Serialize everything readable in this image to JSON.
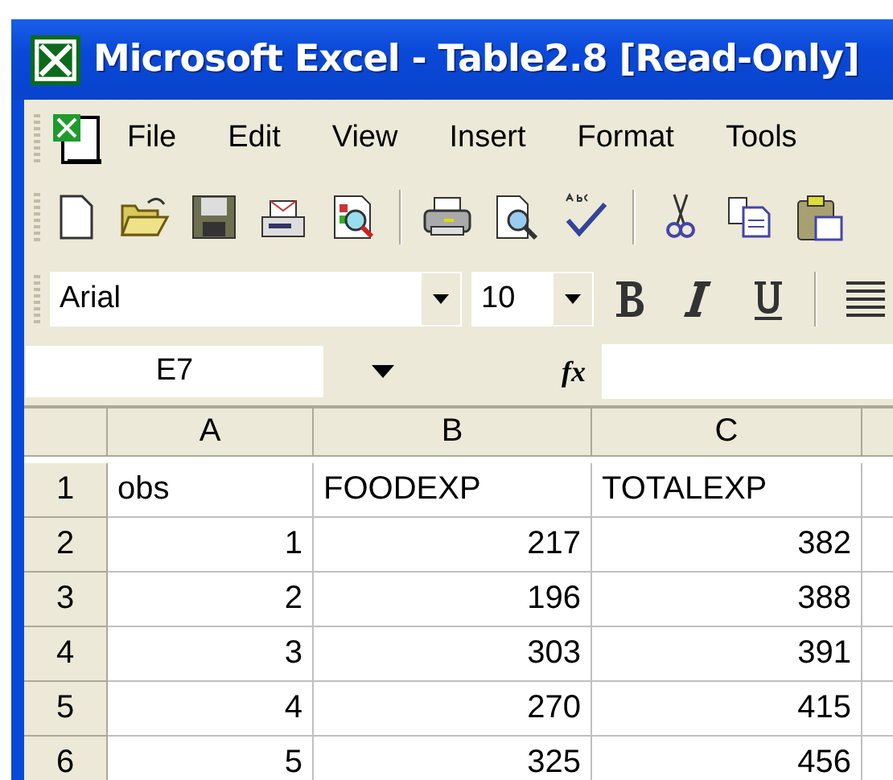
{
  "window": {
    "title": "Microsoft Excel - Table2.8  [Read-Only]"
  },
  "menu_bar": {
    "items": [
      "File",
      "Edit",
      "View",
      "Insert",
      "Format",
      "Tools"
    ]
  },
  "standard_toolbar": {
    "buttons": [
      {
        "kind": "new"
      },
      {
        "kind": "open"
      },
      {
        "kind": "save"
      },
      {
        "kind": "mail"
      },
      {
        "kind": "research"
      },
      {
        "kind": "separator"
      },
      {
        "kind": "print"
      },
      {
        "kind": "preview"
      },
      {
        "kind": "spelling"
      },
      {
        "kind": "separator"
      },
      {
        "kind": "cut"
      },
      {
        "kind": "copy"
      },
      {
        "kind": "paste"
      }
    ]
  },
  "formatting_toolbar": {
    "font": "Arial",
    "size": "10",
    "buttons": [
      {
        "kind": "bold"
      },
      {
        "kind": "italic"
      },
      {
        "kind": "underline"
      },
      {
        "kind": "separator"
      },
      {
        "kind": "align"
      }
    ]
  },
  "formula_bar": {
    "name_box": "E7",
    "function_label": "fx"
  },
  "sheet": {
    "columns": [
      "A",
      "B",
      "C"
    ],
    "rows": [
      {
        "header": "1",
        "cells": [
          {
            "value": "obs",
            "kind": "text"
          },
          {
            "value": "FOODEXP",
            "kind": "text"
          },
          {
            "value": "TOTALEXP",
            "kind": "text"
          }
        ]
      },
      {
        "header": "2",
        "cells": [
          {
            "value": "1",
            "kind": "number"
          },
          {
            "value": "217",
            "kind": "number"
          },
          {
            "value": "382",
            "kind": "number"
          }
        ]
      },
      {
        "header": "3",
        "cells": [
          {
            "value": "2",
            "kind": "number"
          },
          {
            "value": "196",
            "kind": "number"
          },
          {
            "value": "388",
            "kind": "number"
          }
        ]
      },
      {
        "header": "4",
        "cells": [
          {
            "value": "3",
            "kind": "number"
          },
          {
            "value": "303",
            "kind": "number"
          },
          {
            "value": "391",
            "kind": "number"
          }
        ]
      },
      {
        "header": "5",
        "cells": [
          {
            "value": "4",
            "kind": "number"
          },
          {
            "value": "270",
            "kind": "number"
          },
          {
            "value": "415",
            "kind": "number"
          }
        ]
      },
      {
        "header": "6",
        "cells": [
          {
            "value": "5",
            "kind": "number"
          },
          {
            "value": "325",
            "kind": "number"
          },
          {
            "value": "456",
            "kind": "number"
          }
        ]
      }
    ]
  }
}
